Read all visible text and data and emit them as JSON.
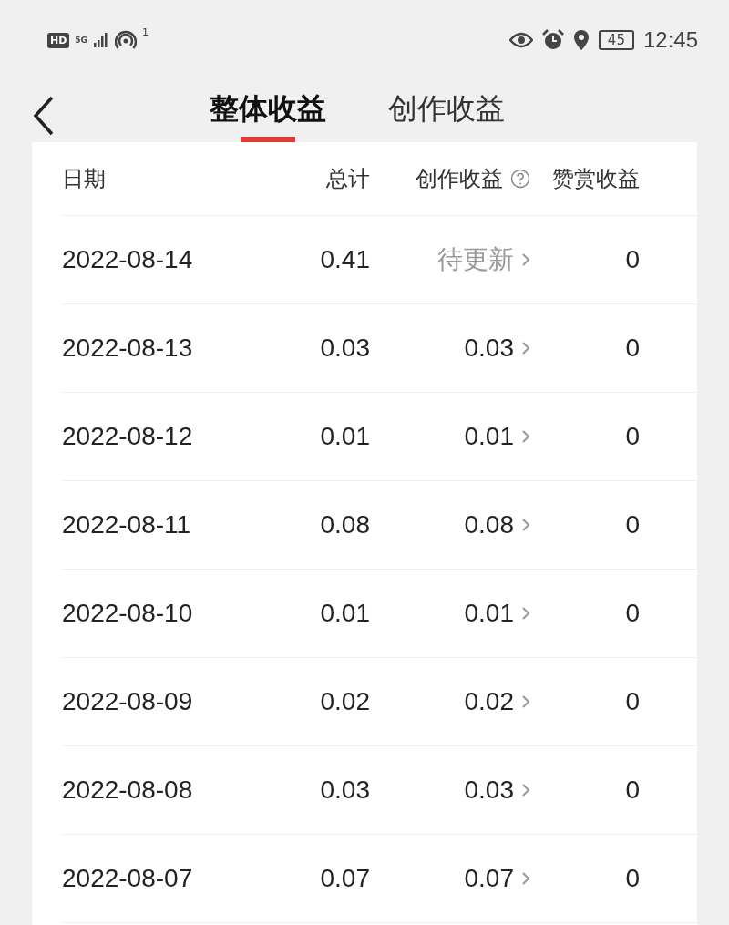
{
  "status_bar": {
    "hd": "HD",
    "network": "5G",
    "hotspot_count": "1",
    "battery": "45",
    "time": "12:45"
  },
  "tabs": [
    {
      "label": "整体收益",
      "selected": true
    },
    {
      "label": "创作收益",
      "selected": false
    }
  ],
  "table": {
    "columns": [
      "日期",
      "总计",
      "创作收益",
      "赞赏收益"
    ],
    "rows": [
      {
        "date": "2022-08-14",
        "total": "0.41",
        "creation": "待更新",
        "creation_pending": true,
        "tips": "0"
      },
      {
        "date": "2022-08-13",
        "total": "0.03",
        "creation": "0.03",
        "creation_pending": false,
        "tips": "0"
      },
      {
        "date": "2022-08-12",
        "total": "0.01",
        "creation": "0.01",
        "creation_pending": false,
        "tips": "0"
      },
      {
        "date": "2022-08-11",
        "total": "0.08",
        "creation": "0.08",
        "creation_pending": false,
        "tips": "0"
      },
      {
        "date": "2022-08-10",
        "total": "0.01",
        "creation": "0.01",
        "creation_pending": false,
        "tips": "0"
      },
      {
        "date": "2022-08-09",
        "total": "0.02",
        "creation": "0.02",
        "creation_pending": false,
        "tips": "0"
      },
      {
        "date": "2022-08-08",
        "total": "0.03",
        "creation": "0.03",
        "creation_pending": false,
        "tips": "0"
      },
      {
        "date": "2022-08-07",
        "total": "0.07",
        "creation": "0.07",
        "creation_pending": false,
        "tips": "0"
      }
    ]
  }
}
